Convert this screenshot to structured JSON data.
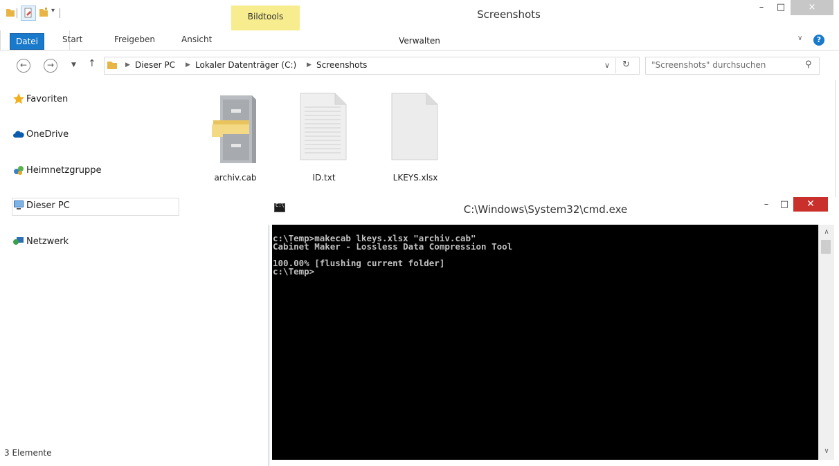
{
  "window": {
    "title": "Screenshots",
    "contextual_tab": "Bildtools",
    "minimize_glyph": "–",
    "maximize_glyph": "□",
    "close_glyph": "×"
  },
  "ribbon": {
    "tabs": [
      "Datei",
      "Start",
      "Freigeben",
      "Ansicht",
      "Verwalten"
    ],
    "help_glyph": "?"
  },
  "address": {
    "breadcrumbs": [
      "Dieser PC",
      "Lokaler Datenträger (C:)",
      "Screenshots"
    ],
    "search_placeholder": "\"Screenshots\" durchsuchen"
  },
  "nav": {
    "items": [
      "Favoriten",
      "OneDrive",
      "Heimnetzgruppe",
      "Dieser PC",
      "Netzwerk"
    ]
  },
  "files": [
    {
      "name": "archiv.cab",
      "icon": "cabinet-icon"
    },
    {
      "name": "ID.txt",
      "icon": "text-file-icon"
    },
    {
      "name": "LKEYS.xlsx",
      "icon": "blank-file-icon"
    }
  ],
  "status": {
    "item_count": "3 Elemente"
  },
  "cmd": {
    "title": "C:\\Windows\\System32\\cmd.exe",
    "minimize_glyph": "–",
    "maximize_glyph": "□",
    "close_glyph": "✕",
    "console_text": "c:\\Temp>makecab lkeys.xlsx \"archiv.cab\"\nCabinet Maker - Lossless Data Compression Tool\n\n100.00% [flushing current folder]\nc:\\Temp>"
  },
  "colors": {
    "accent": "#1979ca",
    "bildtools": "#f7ec8e",
    "cmd_close": "#c9302c"
  }
}
